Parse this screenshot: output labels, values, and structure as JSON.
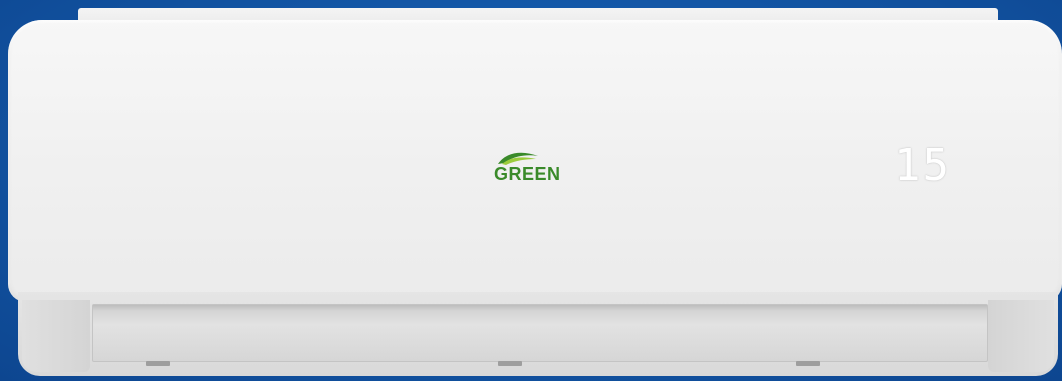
{
  "product": {
    "brand_logo_text": "GREEN",
    "display_value": "15",
    "colors": {
      "background": "#1458a8",
      "panel": "#f2f2f2",
      "logo_green": "#3a8a2a",
      "logo_leaf_light": "#9ccc3c"
    }
  }
}
